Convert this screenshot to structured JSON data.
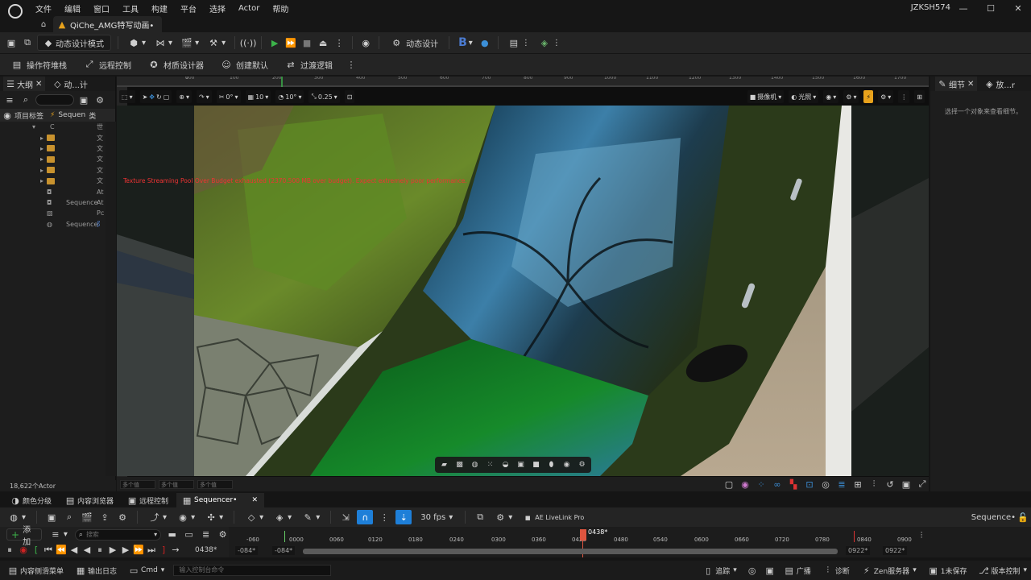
{
  "menu": {
    "items": [
      "文件",
      "编辑",
      "窗口",
      "工具",
      "构建",
      "平台",
      "选择",
      "Actor",
      "帮助"
    ]
  },
  "document_tab": {
    "title": "QiChe_AMG特写动画•"
  },
  "user": {
    "name": "JZKSH574"
  },
  "toolbar": {
    "mode_label": "动态设计模式",
    "dynamic_design_label": "动态设计"
  },
  "toolbar2": {
    "items": [
      "操作符堆栈",
      "远程控制",
      "材质设计器",
      "创建默认",
      "过渡逻辑"
    ]
  },
  "outliner": {
    "tab_label": "大纲",
    "tab2_label": "动...计",
    "header_label": "项目标签",
    "header_col2": "Sequen",
    "header_col3": "类",
    "rows": [
      {
        "col1": "C",
        "col2": "",
        "col3": "世"
      },
      {
        "col1": "",
        "col2": "",
        "col3": "文"
      },
      {
        "col1": "",
        "col2": "",
        "col3": "文"
      },
      {
        "col1": "",
        "col2": "",
        "col3": "文"
      },
      {
        "col1": "",
        "col2": "",
        "col3": "文"
      },
      {
        "col1": "",
        "col2": "",
        "col3": "文"
      },
      {
        "col1": "",
        "col2": "",
        "col3": "At"
      },
      {
        "col1": "",
        "col2": "Sequence",
        "col3": "At"
      },
      {
        "col1": "",
        "col2": "",
        "col3": "Pc"
      },
      {
        "col1": "",
        "col2": "Sequence",
        "col3": "阝"
      }
    ],
    "actor_count": "18,622个Actor"
  },
  "viewport": {
    "ruler_ticks": [
      "100",
      "0",
      "100",
      "200",
      "300",
      "400",
      "500",
      "600",
      "700",
      "800",
      "900",
      "1000",
      "1100",
      "1200",
      "1300",
      "1400",
      "1500",
      "1600",
      "1700"
    ],
    "grid_snap": "0°",
    "snap_10": "10",
    "rot_snap": "10°",
    "scale_snap": "0.25",
    "camera_label": "摄像机",
    "lighting_label": "光照",
    "warning": "Texture Streaming Pool Over Budget exhausted (2370.500 MB over budget). Expect extremely poor performance.",
    "status_values": [
      "多个值",
      "多个值",
      "多个值"
    ]
  },
  "details": {
    "tab_label": "细节",
    "tab2_label": "放...r",
    "empty_message": "选择一个对象来查看细节。"
  },
  "bottom_tabs": [
    "颜色分级",
    "内容浏览器",
    "远程控制",
    "Sequencer•"
  ],
  "sequencer": {
    "fps": "30 fps",
    "livelink": "AE LiveLink Pro",
    "sequence_name": "Sequence•",
    "add_label": "添加",
    "search_placeholder": "搜索",
    "current_frame": "0438*",
    "playhead_label": "0438*",
    "range_start_outer": "-084*",
    "range_start_inner": "-084*",
    "range_end_inner": "0922*",
    "range_end_outer": "0922*",
    "ticks": [
      "-060",
      "0000",
      "0060",
      "0120",
      "0180",
      "0240",
      "0300",
      "0360",
      "0420",
      "0480",
      "0540",
      "0600",
      "0660",
      "0720",
      "0780",
      "0840",
      "0900"
    ]
  },
  "statusbar": {
    "content_drawer": "内容侧滑菜单",
    "output_log": "输出日志",
    "cmd": "Cmd",
    "console_placeholder": "输入控制台命令",
    "trace": "追踪",
    "broadcast": "广播",
    "diagnose": "诊断",
    "zen": "Zen服务器",
    "unsaved": "1未保存",
    "version_control": "版本控制"
  },
  "colors": {
    "accent_blue": "#1e7fd8",
    "play_green": "#3cb34a",
    "playhead_red": "#e0553f",
    "warning_red": "#e33333",
    "snap_orange": "#e8a21c"
  }
}
